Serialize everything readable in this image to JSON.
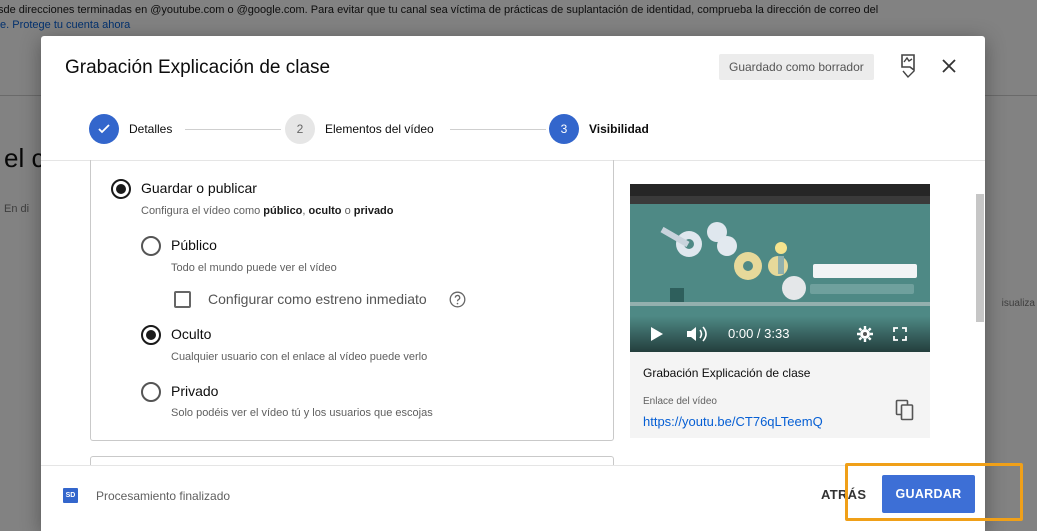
{
  "background": {
    "notice_line1": "sde direcciones terminadas en @youtube.com o @google.com. Para evitar que tu canal sea víctima de prácticas de suplantación de identidad, comprueba la dirección de correo del",
    "notice_line2": "e. Protege tu cuenta ahora",
    "title_fragment": "el c",
    "sub_fragment": "En di",
    "right_fragment": "isualiza"
  },
  "dialog": {
    "title": "Grabación Explicación de clase",
    "draft_badge": "Guardado como borrador"
  },
  "stepper": {
    "steps": [
      {
        "number": "✓",
        "label": "Detalles",
        "state": "done"
      },
      {
        "number": "2",
        "label": "Elementos del vídeo",
        "state": "idle"
      },
      {
        "number": "3",
        "label": "Visibilidad",
        "state": "active"
      }
    ]
  },
  "visibility": {
    "save_publish": {
      "title": "Guardar o publicar",
      "desc_prefix": "Configura el vídeo como ",
      "desc_public": "público",
      "desc_sep1": ", ",
      "desc_unlisted": "oculto",
      "desc_sep2": " o ",
      "desc_private": "privado"
    },
    "public": {
      "title": "Público",
      "desc": "Todo el mundo puede ver el vídeo"
    },
    "premiere": {
      "label": "Configurar como estreno inmediato"
    },
    "unlisted": {
      "title": "Oculto",
      "desc": "Cualquier usuario con el enlace al vídeo puede verlo"
    },
    "private": {
      "title": "Privado",
      "desc": "Solo podéis ver el vídeo tú y los usuarios que escojas"
    },
    "selected": "Oculto"
  },
  "preview": {
    "time": "0:00 / 3:33",
    "title": "Grabación Explicación de clase",
    "link_label": "Enlace del vídeo",
    "link": "https://youtu.be/CT76qLTeemQ"
  },
  "footer": {
    "badge": "SD",
    "status": "Procesamiento finalizado",
    "back": "ATRÁS",
    "save": "GUARDAR"
  },
  "colors": {
    "accent": "#3366cc",
    "save_button": "#3d6fd6",
    "link": "#065fd4",
    "highlight": "#f0a018"
  }
}
